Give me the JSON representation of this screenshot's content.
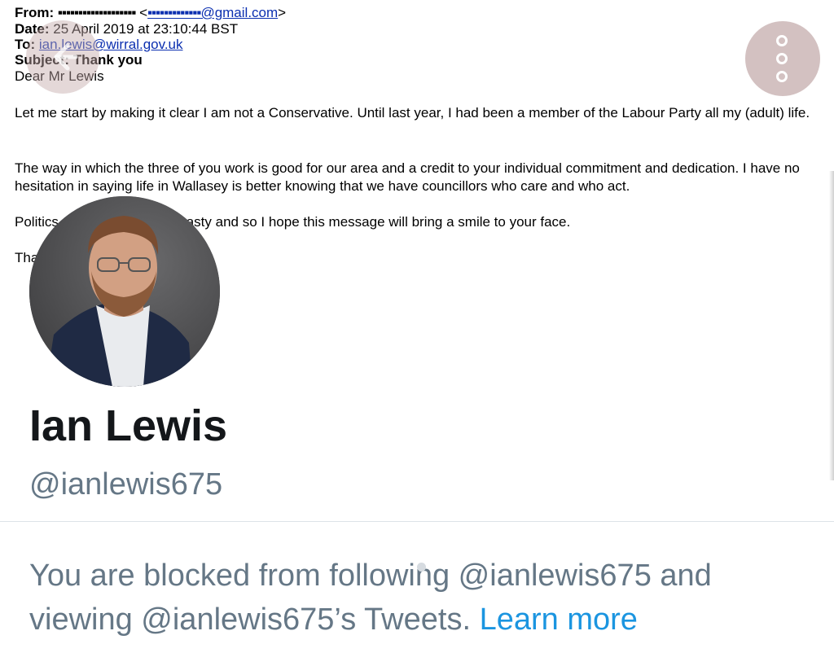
{
  "email": {
    "from_label": "From:",
    "from_redacted_name": "▪▪▪▪▪▪▪▪▪▪▪▪▪▪▪▪▪▪▪",
    "from_open": "<",
    "from_redacted_user": "▪▪▪▪▪▪▪▪▪▪▪▪▪",
    "from_domain": "@gmail.com",
    "from_close": ">",
    "date_label": "Date:",
    "date_value": "25 April 2019 at 23:10:44 BST",
    "to_label": "To:",
    "to_value": "ian.lewis@wirral.gov.uk",
    "subject_label": "Subject:",
    "subject_value": "Thank you",
    "greeting": "Dear Mr Lewis",
    "para1": "Let me start by making it clear I am not a Conservative. Until last year, I had been a member of the Labour Party all my (adult) life.",
    "para2": "The way in which the three of you work is good for our area and a credit to your individual commitment and dedication. I have no hesitation in saying life in Wallasey is better knowing that we have councillors who care and who act.",
    "para3": "Politics can be messy and nasty and so I hope this message will bring a smile to your face.",
    "para4": "Thank you"
  },
  "profile": {
    "name": "Ian Lewis",
    "handle": "@ianlewis675",
    "blocked_message": "You are blocked from following @ianlewis675 and viewing @ianlewis675’s Tweets.",
    "learn_more": "Learn more"
  },
  "icons": {
    "back": "arrow-left-icon",
    "more": "more-vertical-icon"
  },
  "colors": {
    "name_text": "#14171a",
    "secondary_text": "#657786",
    "link_blue": "#1b95e0",
    "more_button_bg": "#d3c1c1"
  }
}
